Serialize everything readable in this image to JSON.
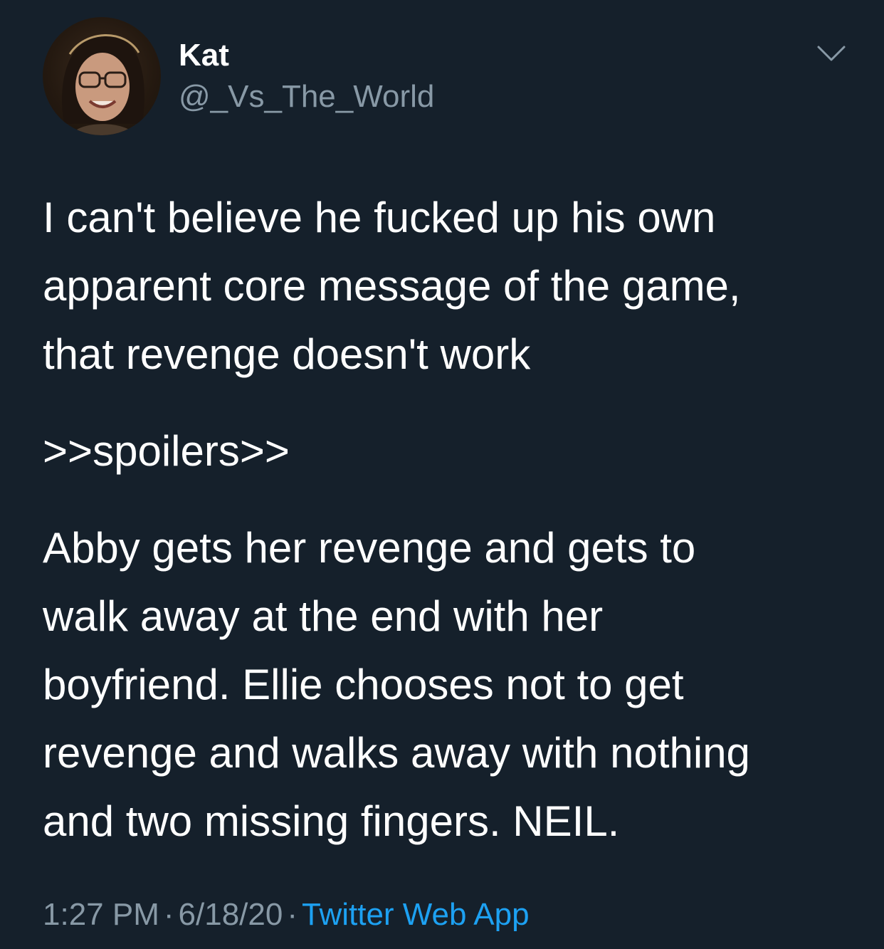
{
  "tweet": {
    "author": {
      "name": "Kat",
      "handle": "@_Vs_The_World",
      "avatar_icon": "profile-photo"
    },
    "menu_icon": "chevron-down-icon",
    "paragraphs": [
      "I can't believe he fucked up his own\napparent core message of the game,\nthat revenge doesn't work",
      ">>spoilers>>",
      "Abby gets her revenge and gets to\nwalk away at the end with her\nboyfriend. Ellie chooses not to get\nrevenge and walks away with nothing\nand two missing fingers. NEIL."
    ],
    "time": "1:27 PM",
    "date": "6/18/20",
    "separator": "·",
    "source": "Twitter Web App"
  },
  "colors": {
    "background": "#15202b",
    "primary_text": "#ffffff",
    "secondary_text": "#8899a6",
    "link": "#1da1f2"
  }
}
